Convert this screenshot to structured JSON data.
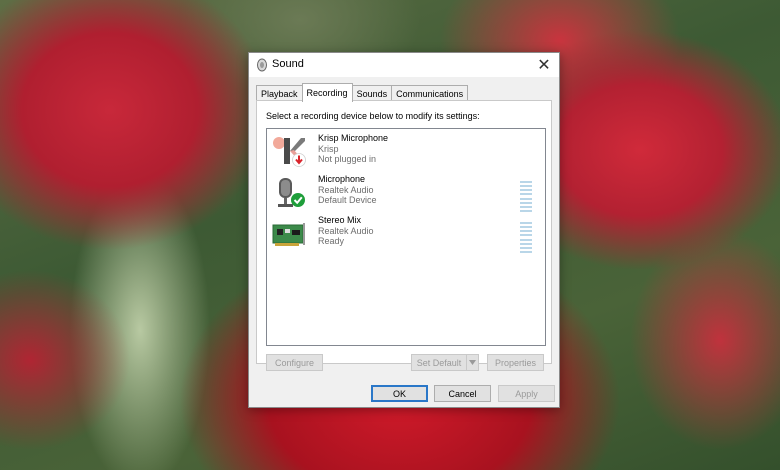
{
  "window": {
    "title": "Sound",
    "close_symbol": "✕"
  },
  "tabs": [
    {
      "label": "Playback",
      "active": false
    },
    {
      "label": "Recording",
      "active": true
    },
    {
      "label": "Sounds",
      "active": false
    },
    {
      "label": "Communications",
      "active": false
    }
  ],
  "recording": {
    "instruction": "Select a recording device below to modify its settings:",
    "devices": [
      {
        "name": "Krisp Microphone",
        "driver": "Krisp",
        "status": "Not plugged in",
        "icon": "krisp-icon",
        "badge": "red-down-arrow"
      },
      {
        "name": "Microphone",
        "driver": "Realtek Audio",
        "status": "Default Device",
        "icon": "microphone-icon",
        "badge": "green-check"
      },
      {
        "name": "Stereo Mix",
        "driver": "Realtek Audio",
        "status": "Ready",
        "icon": "sound-card-icon",
        "badge": ""
      }
    ],
    "buttons": {
      "configure": "Configure",
      "set_default": "Set Default",
      "properties": "Properties"
    }
  },
  "footer": {
    "ok": "OK",
    "cancel": "Cancel",
    "apply": "Apply"
  },
  "colors": {
    "default_button_border": "#2a77c8",
    "level_meter": "#b9d6e8",
    "check_green": "#1e9e3a",
    "down_red": "#d9242b"
  }
}
